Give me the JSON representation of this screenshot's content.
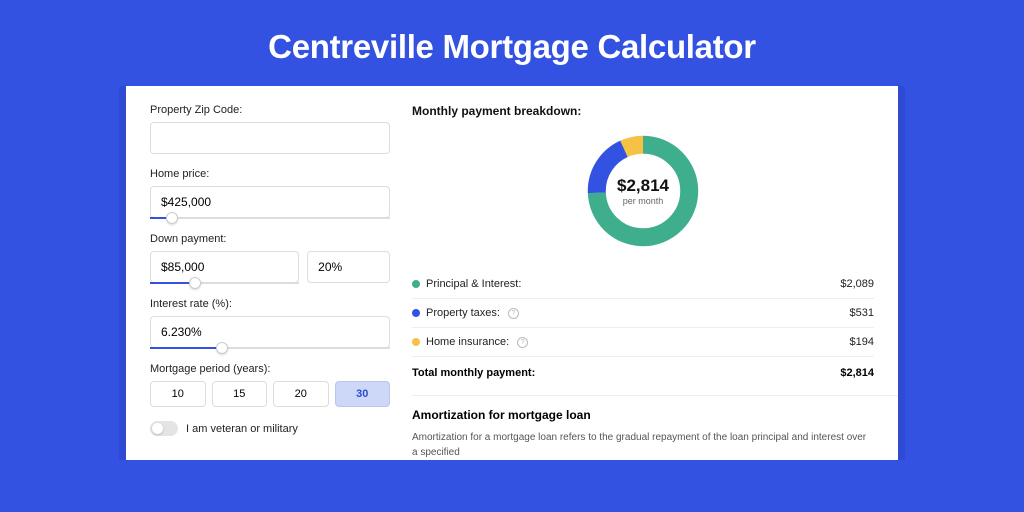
{
  "page_title": "Centreville Mortgage Calculator",
  "colors": {
    "principal": "#3fae8c",
    "taxes": "#3452e1",
    "insurance": "#f5c244"
  },
  "left": {
    "zip_label": "Property Zip Code:",
    "zip_value": "",
    "home_price_label": "Home price:",
    "home_price_value": "$425,000",
    "down_payment_label": "Down payment:",
    "down_payment_value": "$85,000",
    "down_payment_pct": "20%",
    "interest_label": "Interest rate (%):",
    "interest_value": "6.230%",
    "period_label": "Mortgage period (years):",
    "periods": [
      "10",
      "15",
      "20",
      "30"
    ],
    "period_selected": "30",
    "veteran_label": "I am veteran or military"
  },
  "right": {
    "breakdown_title": "Monthly payment breakdown:",
    "donut_amount": "$2,814",
    "donut_sub": "per month",
    "legend": [
      {
        "label": "Principal & Interest:",
        "value": "$2,089",
        "info": false
      },
      {
        "label": "Property taxes:",
        "value": "$531",
        "info": true
      },
      {
        "label": "Home insurance:",
        "value": "$194",
        "info": true
      }
    ],
    "total_label": "Total monthly payment:",
    "total_value": "$2,814",
    "amort_title": "Amortization for mortgage loan",
    "amort_text": "Amortization for a mortgage loan refers to the gradual repayment of the loan principal and interest over a specified"
  },
  "chart_data": {
    "type": "pie",
    "title": "Monthly payment breakdown",
    "series": [
      {
        "name": "Principal & Interest",
        "value": 2089,
        "color": "#3fae8c"
      },
      {
        "name": "Property taxes",
        "value": 531,
        "color": "#3452e1"
      },
      {
        "name": "Home insurance",
        "value": 194,
        "color": "#f5c244"
      }
    ],
    "total": 2814,
    "center_label": "$2,814 per month"
  }
}
